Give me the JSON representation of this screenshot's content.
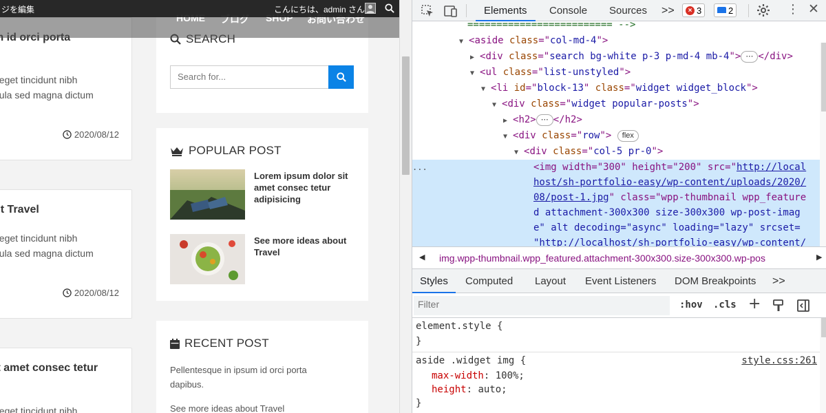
{
  "adminbar": {
    "edit_page": "ジを編集",
    "greeting": "こんにちは、admin さん"
  },
  "nav": {
    "home": "HOME",
    "blog": "ブログ",
    "shop": "SHOP",
    "contact": "お問い合わせ"
  },
  "posts": [
    {
      "title": "m id orci porta",
      "excerpt1": ", eget tincidunt nibh",
      "excerpt2": "gula sed magna dictum",
      "date": "2020/08/12"
    },
    {
      "title": "ut Travel",
      "excerpt1": ", eget tincidunt nibh",
      "excerpt2": "gula sed magna dictum",
      "date": "2020/08/12"
    },
    {
      "title": "it amet consec tetur",
      "excerpt1": ", eget tincidunt nibh",
      "excerpt2": "",
      "date": ""
    }
  ],
  "search": {
    "title": "SEARCH",
    "placeholder": "Search for..."
  },
  "popular": {
    "title": "POPULAR POST",
    "items": [
      {
        "text": "Lorem ipsum dolor sit amet consec tetur adipisicing"
      },
      {
        "text": "See more ideas about Travel"
      }
    ]
  },
  "recent": {
    "title": "RECENT POST",
    "item1": "Pellentesque in ipsum id orci porta dapibus.",
    "item2": "See more ideas about Travel"
  },
  "devtools": {
    "tabs": [
      "Elements",
      "Console",
      "Sources"
    ],
    "more_tabs": ">>",
    "errors": "3",
    "messages": "2",
    "dom": {
      "l0": "========================= -->",
      "l1_tag": "aside",
      "l1_attr": "class",
      "l1_val": "col-md-4",
      "l2_tag": "div",
      "l2_attr": "class",
      "l2_val": "search bg-white p-3 p-md-4 mb-4",
      "l3_tag": "ul",
      "l3_attr": "class",
      "l3_val": "list-unstyled",
      "l4_tag": "li",
      "l4_attr1": "id",
      "l4_val1": "block-13",
      "l4_attr2": "class",
      "l4_val2": "widget widget_block",
      "l5_tag": "div",
      "l5_attr": "class",
      "l5_val": "widget popular-posts",
      "l6_tag": "h2",
      "l7_tag": "div",
      "l7_attr": "class",
      "l7_val": "row",
      "l7_pill": "flex",
      "l8_tag": "div",
      "l8_attr": "class",
      "l8_val": "col-5 pr-0",
      "img_line1": "<img width=\"300\" height=\"200\" src=\"",
      "img_link1": "http://local",
      "img_link2": "host/sh-portfolio-easy/wp-content/uploads/2020/",
      "img_link3": "08/post-1.jpg",
      "img_line3b": "\" class=\"wpp-thumbnail wpp_feature",
      "img_line4": "d attachment-300x300 size-300x300 wp-post-imag",
      "img_line5": "e\" alt decoding=\"async\" loading=\"lazy\" srcset=",
      "img_link4": "\"http://localhost/sh-portfolio-easy/wp-content/",
      "dots": "..."
    },
    "breadcrumb": "img.wpp-thumbnail.wpp_featured.attachment-300x300.size-300x300.wp-pos",
    "subtabs": [
      "Styles",
      "Computed",
      "Layout",
      "Event Listeners",
      "DOM Breakpoints"
    ],
    "subtabs_more": ">>",
    "filter_placeholder": "Filter",
    "hov": ":hov",
    "cls": ".cls",
    "styles": {
      "element_style": "element.style {",
      "close": "}",
      "rule_selector": "aside .widget img {",
      "rule_source": "style.css:261",
      "p1_name": "max-width",
      "p1_val": "100%;",
      "p2_name": "height",
      "p2_val": "auto;"
    }
  },
  "colors": {
    "accent": "#1a73e8",
    "search_btn": "#0b83e6",
    "selection": "#cfe8fc",
    "error": "#d93025",
    "info": "#1a73e8"
  }
}
